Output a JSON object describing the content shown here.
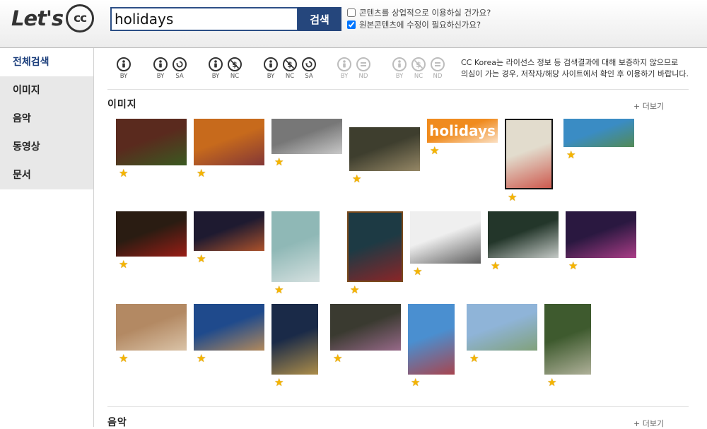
{
  "header": {
    "logo_text": "Let's",
    "logo_badge": "cc",
    "search_value": "holidays",
    "search_button": "검색",
    "options": [
      {
        "label": "콘텐츠를 상업적으로 이용하실 건가요?",
        "checked": false
      },
      {
        "label": "원본콘텐츠에 수정이 필요하신가요?",
        "checked": true
      }
    ],
    "accent_color": "#25467c"
  },
  "sidebar": {
    "items": [
      {
        "label": "전체검색",
        "active": true
      },
      {
        "label": "이미지",
        "active": false
      },
      {
        "label": "음악",
        "active": false
      },
      {
        "label": "동영상",
        "active": false
      },
      {
        "label": "문서",
        "active": false
      }
    ]
  },
  "licenses": {
    "groups": [
      {
        "items": [
          {
            "icon": "by-icon",
            "label": "BY"
          }
        ]
      },
      {
        "items": [
          {
            "icon": "by-icon",
            "label": "BY"
          },
          {
            "icon": "sa-icon",
            "label": "SA"
          }
        ]
      },
      {
        "items": [
          {
            "icon": "by-icon",
            "label": "BY"
          },
          {
            "icon": "nc-icon",
            "label": "NC"
          }
        ]
      },
      {
        "items": [
          {
            "icon": "by-icon",
            "label": "BY"
          },
          {
            "icon": "nc-icon",
            "label": "NC"
          },
          {
            "icon": "sa-icon",
            "label": "SA"
          }
        ]
      },
      {
        "items": [
          {
            "icon": "by-icon",
            "label": "BY"
          },
          {
            "icon": "nd-icon",
            "label": "ND"
          }
        ],
        "dimmed": true
      },
      {
        "items": [
          {
            "icon": "by-icon",
            "label": "BY"
          },
          {
            "icon": "nc-icon",
            "label": "NC"
          },
          {
            "icon": "nd-icon",
            "label": "ND"
          }
        ],
        "dimmed": true
      }
    ],
    "note_line1": "CC Korea는 라이선스 정보 등 검색결과에 대해 보증하지 않으므로",
    "note_line2": "의심이 가는 경우, 저작자/해당 사이트에서  확인 후 이용하기 바랍니다."
  },
  "images_section": {
    "title": "이미지",
    "more": "+ 더보기",
    "thumbs": [
      {
        "name": "christmas-room",
        "bg": "#5a2a1e",
        "fg": "#2f6b22"
      },
      {
        "name": "sunset-flower",
        "bg": "#c76a1c",
        "fg": "#6a2440"
      },
      {
        "name": "bw-building",
        "bg": "#777777",
        "fg": "#e6e6e6"
      },
      {
        "name": "woman-field",
        "bg": "#3e3e2e",
        "fg": "#b5a27a"
      },
      {
        "name": "holidays-sign",
        "bg": "#f08b1e",
        "fg": "#ffffff",
        "text": "holidays"
      },
      {
        "name": "holiday-motel",
        "bg": "#e2dccd",
        "fg": "#c62a20"
      },
      {
        "name": "lake-mountain",
        "bg": "#3a8cc4",
        "fg": "#5c8a2e"
      },
      {
        "name": "poinsettia",
        "bg": "#2a1c12",
        "fg": "#c21e17"
      },
      {
        "name": "night-lights",
        "bg": "#1e1a30",
        "fg": "#e0662a"
      },
      {
        "name": "milk-carton",
        "bg": "#8fb8b6",
        "fg": "#efefef"
      },
      {
        "name": "old-man",
        "bg": "#1d3a44",
        "fg": "#b01e1e"
      },
      {
        "name": "toy-cars",
        "bg": "#efefef",
        "fg": "#2a2a2a"
      },
      {
        "name": "holiday-print-giveaway",
        "bg": "#23362a",
        "fg": "#ffffff"
      },
      {
        "name": "bokeh-lights",
        "bg": "#2a1840",
        "fg": "#d94aa0"
      },
      {
        "name": "gingerbread-cookies",
        "bg": "#b38963",
        "fg": "#e8d8c0"
      },
      {
        "name": "city-dusk",
        "bg": "#1f4a8c",
        "fg": "#e8a04a"
      },
      {
        "name": "xmas-tree-window",
        "bg": "#1a2a48",
        "fg": "#e2b14a"
      },
      {
        "name": "ornaments",
        "bg": "#3a3a30",
        "fg": "#b87aa8"
      },
      {
        "name": "motel-sign",
        "bg": "#4a8fd0",
        "fg": "#c92a20"
      },
      {
        "name": "beach-dunes",
        "bg": "#8fb4d8",
        "fg": "#7c9a58"
      },
      {
        "name": "owl",
        "bg": "#3e5a2e",
        "fg": "#d8d0c0"
      }
    ]
  },
  "music_section": {
    "title": "음악",
    "more": "+ 더보기"
  }
}
